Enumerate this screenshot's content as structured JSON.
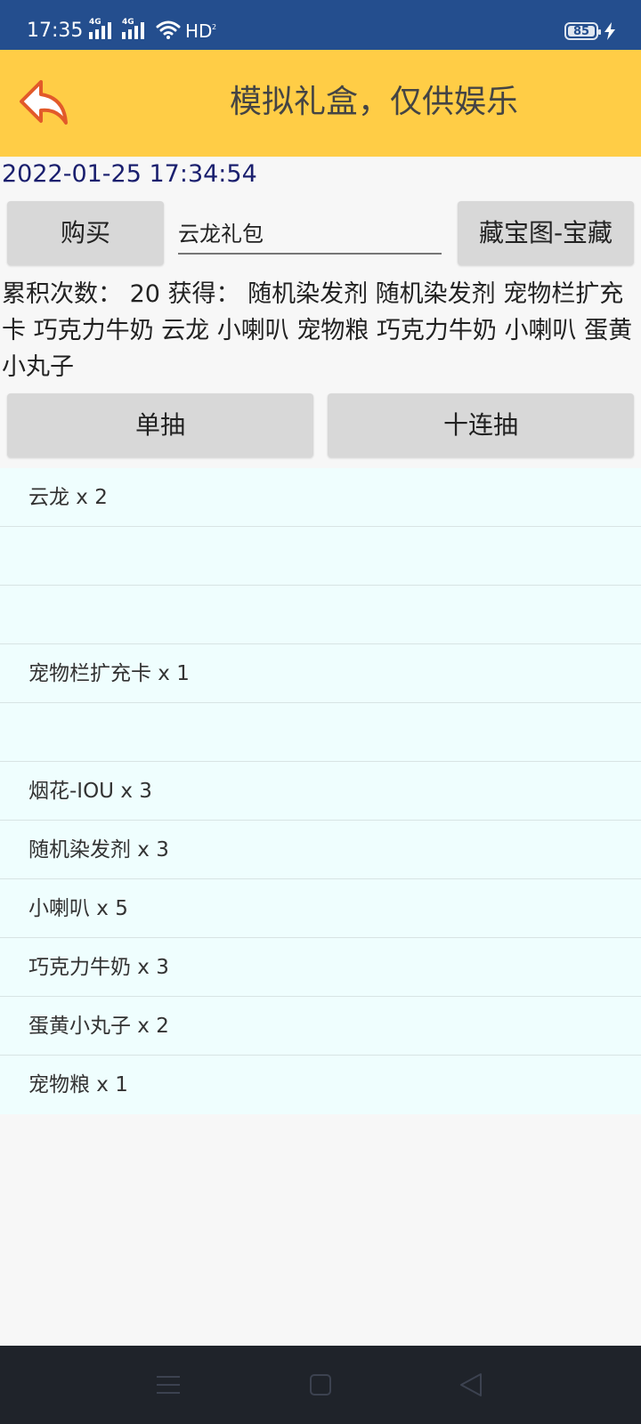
{
  "status": {
    "time": "17:35",
    "net1": "4G",
    "net2": "4G",
    "hd": "HD",
    "hd_sub": "2",
    "battery": "85"
  },
  "header": {
    "title": "模拟礼盒，仅供娱乐"
  },
  "datetime": "2022-01-25 17:34:54",
  "controls": {
    "buy_label": "购买",
    "gift_input_value": "云龙礼包",
    "treasure_label": "藏宝图-宝藏"
  },
  "accumulation": "累积次数： 20 获得：  随机染发剂 随机染发剂 宠物栏扩充卡 巧克力牛奶 云龙 小喇叭 宠物粮 巧克力牛奶 小喇叭 蛋黄小丸子",
  "draw": {
    "single_label": "单抽",
    "ten_label": "十连抽"
  },
  "items": [
    "云龙 x 2",
    "",
    "",
    "宠物栏扩充卡 x 1",
    "",
    "烟花-IOU x 3",
    "随机染发剂 x 3",
    "小喇叭 x 5",
    "巧克力牛奶 x 3",
    "蛋黄小丸子 x 2",
    "宠物粮 x 1"
  ],
  "colors": {
    "status_bar": "#244e8e",
    "app_bar": "#ffcd46",
    "list_bg": "#effefe",
    "nav_bar": "#1f232a",
    "date_text": "#1a1f6e"
  },
  "icons": {
    "back": "back-arrow-icon",
    "wifi": "wifi-icon",
    "bolt": "charging-icon",
    "nav_menu": "menu-icon",
    "nav_home": "home-icon",
    "nav_back": "nav-back-icon"
  }
}
